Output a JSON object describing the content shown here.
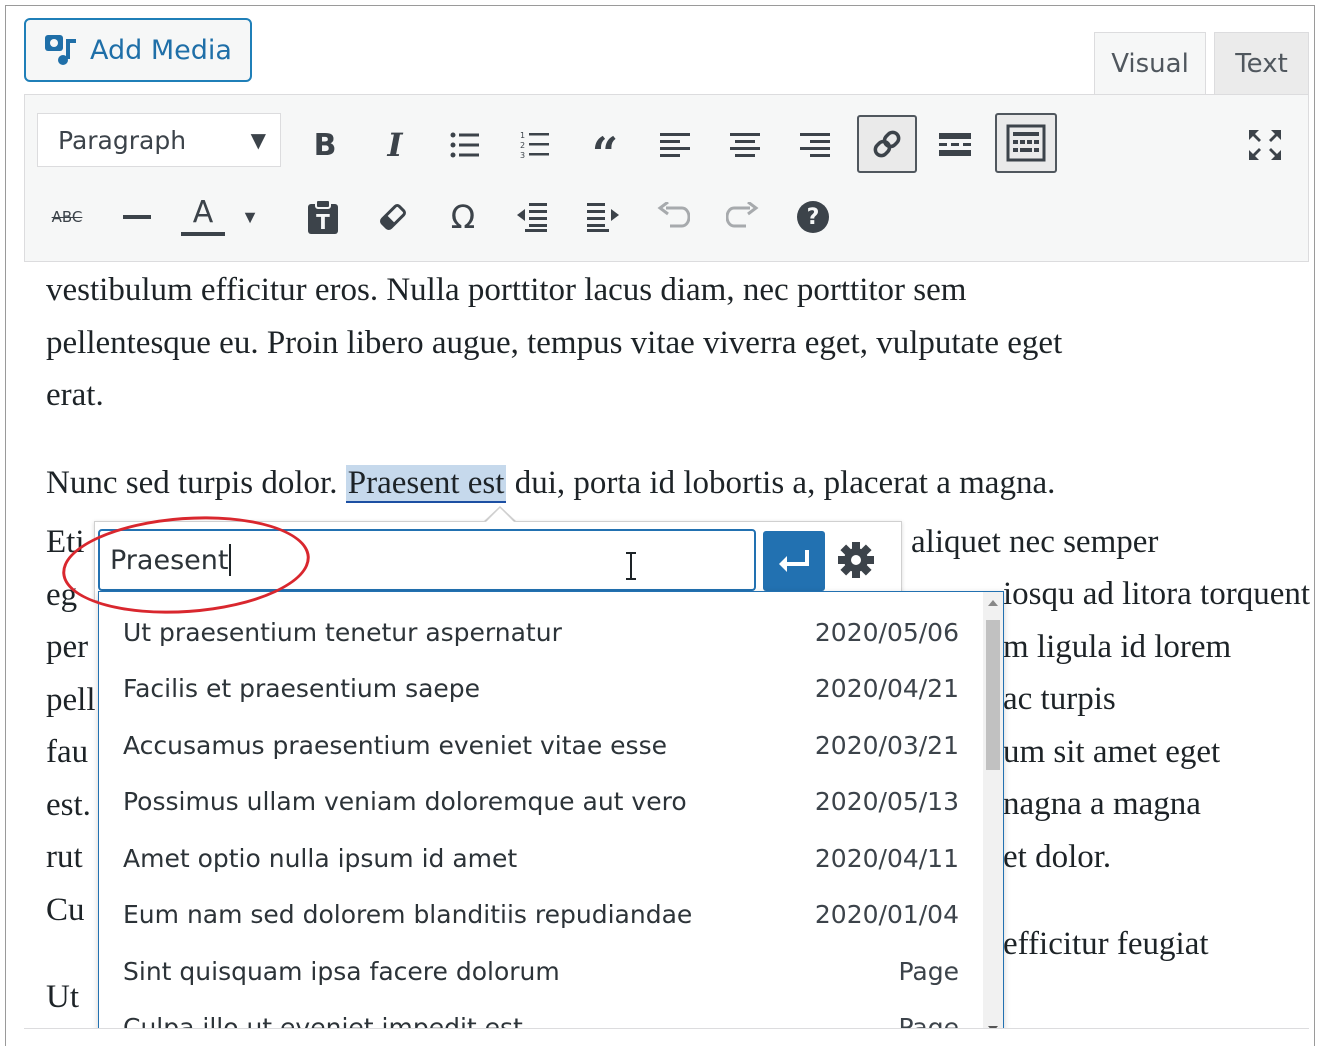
{
  "editor": {
    "add_media_label": "Add Media",
    "tabs": [
      {
        "label": "Visual",
        "active": true
      },
      {
        "label": "Text",
        "active": false
      }
    ],
    "format_select": "Paragraph"
  },
  "toolbar_icons": {
    "row1": [
      "bold-icon",
      "italic-icon",
      "bullet-list-icon",
      "numbered-list-icon",
      "blockquote-icon",
      "align-left-icon",
      "align-center-icon",
      "align-right-icon",
      "link-icon",
      "read-more-icon",
      "toolbar-toggle-icon",
      "fullscreen-icon"
    ],
    "row2": [
      "strikethrough-icon",
      "horizontal-line-icon",
      "text-color-icon",
      "paste-text-icon",
      "clear-formatting-icon",
      "special-character-icon",
      "outdent-icon",
      "indent-icon",
      "undo-icon",
      "redo-icon",
      "help-icon"
    ]
  },
  "toolbar_text": {
    "bold": "B",
    "italic": "I",
    "quote": "“",
    "strike": "ABC",
    "color": "A",
    "omega": "Ω",
    "help": "?"
  },
  "content": {
    "para1_lines": [
      "vestibulum efficitur eros. Nulla porttitor lacus diam, nec porttitor sem",
      "pellentesque eu. Proin libero augue, tempus vitae viverra eget, vulputate eget",
      "erat."
    ],
    "para2_before": "Nunc sed turpis dolor. ",
    "para2_selected": "Praesent est",
    "para2_after": " dui, porta id lobortis a, placerat a magna.",
    "para2_visible_left": [
      "Eti",
      "eg",
      "per",
      "pell",
      "fau",
      "est.",
      "rut",
      "Cu"
    ],
    "para2_visible_right": [
      "aliquet nec semper",
      "iosqu ad litora torquent",
      "m ligula id lorem",
      "ac turpis",
      "um sit amet eget",
      "nagna a magna",
      "et dolor."
    ],
    "para3_left": "Ut",
    "para3_right": "efficitur feugiat"
  },
  "link_popup": {
    "input_value": "Praesent",
    "results": [
      {
        "title": "Ut praesentium tenetur aspernatur",
        "info": "2020/05/06"
      },
      {
        "title": "Facilis et praesentium saepe",
        "info": "2020/04/21"
      },
      {
        "title": "Accusamus praesentium eveniet vitae esse",
        "info": "2020/03/21"
      },
      {
        "title": "Possimus ullam veniam doloremque aut vero",
        "info": "2020/05/13"
      },
      {
        "title": "Amet optio nulla ipsum id amet",
        "info": "2020/04/11"
      },
      {
        "title": "Eum nam sed dolorem blanditiis repudiandae",
        "info": "2020/01/04"
      },
      {
        "title": "Sint quisquam ipsa facere dolorum",
        "info": "Page"
      },
      {
        "title": "Culpa illo ut eveniet impedit est",
        "info": "Page"
      }
    ]
  },
  "colors": {
    "accent": "#2271b1",
    "annotation": "#d9272e"
  }
}
